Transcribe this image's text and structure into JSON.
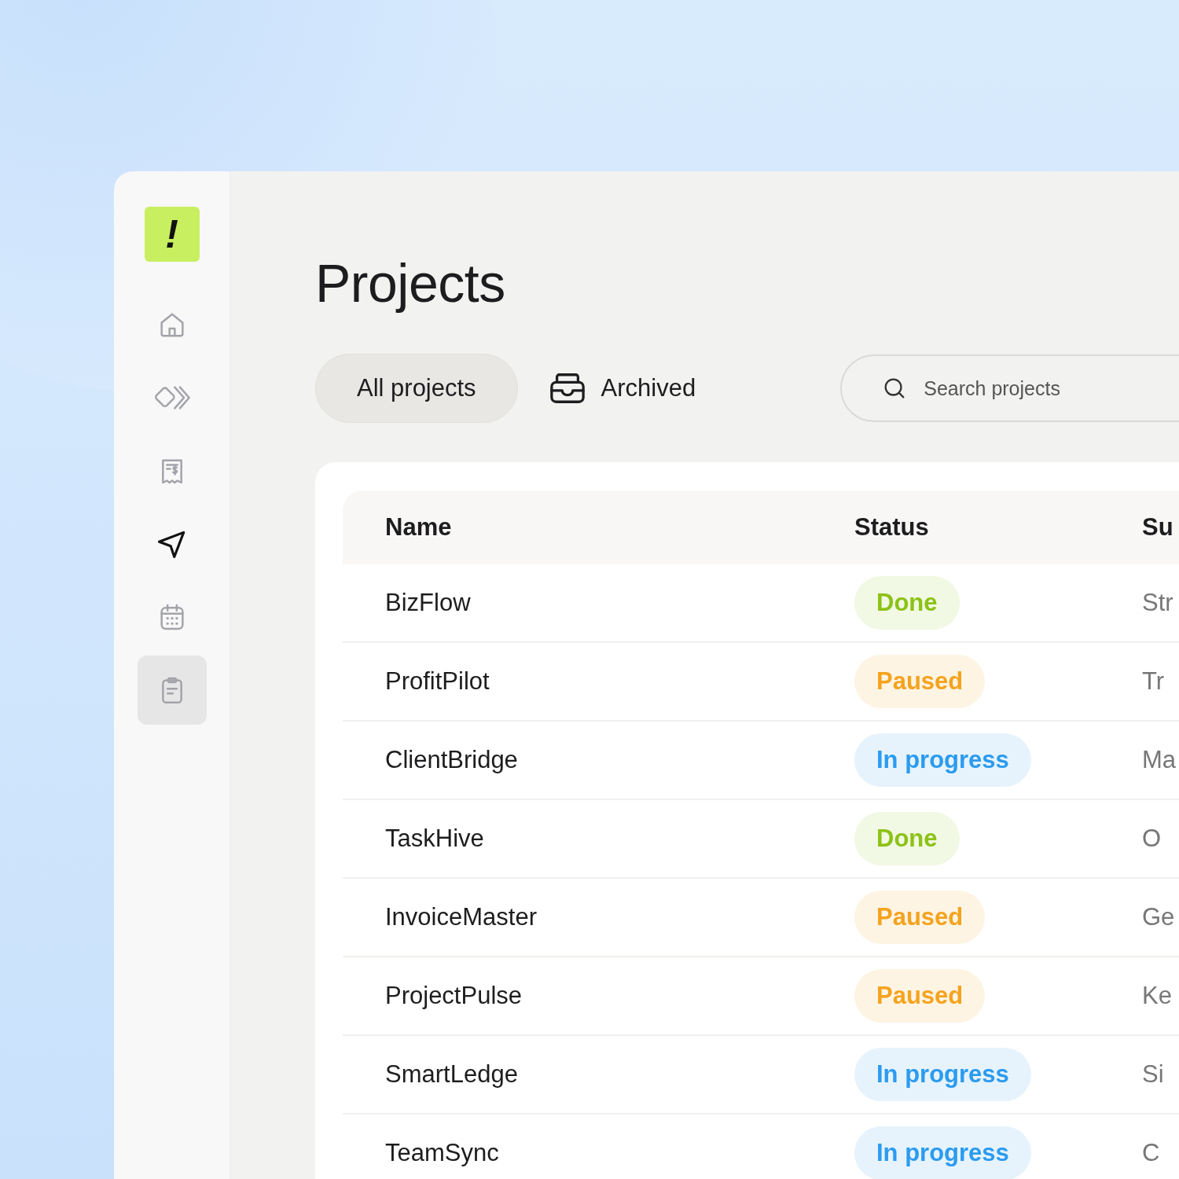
{
  "sidebar": {
    "logo": "!",
    "items": [
      {
        "kind": "home",
        "selected": false,
        "highlighted": false
      },
      {
        "kind": "diamond",
        "selected": false,
        "highlighted": false
      },
      {
        "kind": "receipt",
        "selected": false,
        "highlighted": false
      },
      {
        "kind": "send",
        "selected": true,
        "highlighted": false
      },
      {
        "kind": "calendar",
        "selected": false,
        "highlighted": false
      },
      {
        "kind": "clipboard",
        "selected": false,
        "highlighted": true
      }
    ]
  },
  "title": "Projects",
  "tabs": [
    {
      "label": "All projects",
      "selected": true,
      "icon": false
    },
    {
      "label": "Archived",
      "selected": false,
      "icon": true
    }
  ],
  "search": {
    "placeholder": "Search projects"
  },
  "table": {
    "columns": [
      "Name",
      "Status",
      "Su"
    ],
    "rows": [
      {
        "name": "BizFlow",
        "status": {
          "label": "Done",
          "color": "#8cc214"
        },
        "column_3": "Str"
      },
      {
        "name": "ProfitPilot",
        "status": {
          "label": "Paused",
          "color": "#f5a31e"
        },
        "column_3": "Tr"
      },
      {
        "name": "ClientBridge",
        "status": {
          "label": "In progress",
          "color": "#2b9bf0"
        },
        "column_3": "Ma"
      },
      {
        "name": "TaskHive",
        "status": {
          "label": "Done",
          "color": "#8cc214"
        },
        "column_3": "O"
      },
      {
        "name": "InvoiceMaster",
        "status": {
          "label": "Paused",
          "color": "#f5a31e"
        },
        "column_3": "Ge"
      },
      {
        "name": "ProjectPulse",
        "status": {
          "label": "Paused",
          "color": "#f5a31e"
        },
        "column_3": "Ke"
      },
      {
        "name": "SmartLedge",
        "status": {
          "label": "In progress",
          "color": "#2b9bf0"
        },
        "column_3": "Si"
      },
      {
        "name": "TeamSync",
        "status": {
          "label": "In progress",
          "color": "#2b9bf0"
        },
        "column_3": "C"
      }
    ]
  }
}
